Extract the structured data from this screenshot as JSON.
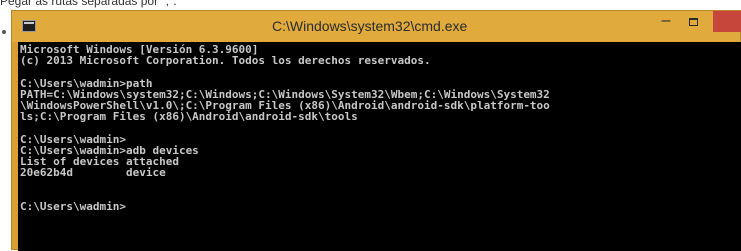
{
  "caption": "Pegar as rutas separadas por \";\".",
  "window": {
    "title": "C:\\Windows\\system32\\cmd.exe"
  },
  "console": {
    "lines": [
      "Microsoft Windows [Versión 6.3.9600]",
      "(c) 2013 Microsoft Corporation. Todos los derechos reservados.",
      "",
      "C:\\Users\\wadmin>path",
      "PATH=C:\\Windows\\system32;C:\\Windows;C:\\Windows\\System32\\Wbem;C:\\Windows\\System32",
      "\\WindowsPowerShell\\v1.0\\;C:\\Program Files (x86)\\Android\\android-sdk\\platform-too",
      "ls;C:\\Program Files (x86)\\Android\\android-sdk\\tools",
      "",
      "C:\\Users\\wadmin>",
      "C:\\Users\\wadmin>adb devices",
      "List of devices attached",
      "20e62b4d        device",
      "",
      "",
      "C:\\Users\\wadmin>"
    ]
  }
}
